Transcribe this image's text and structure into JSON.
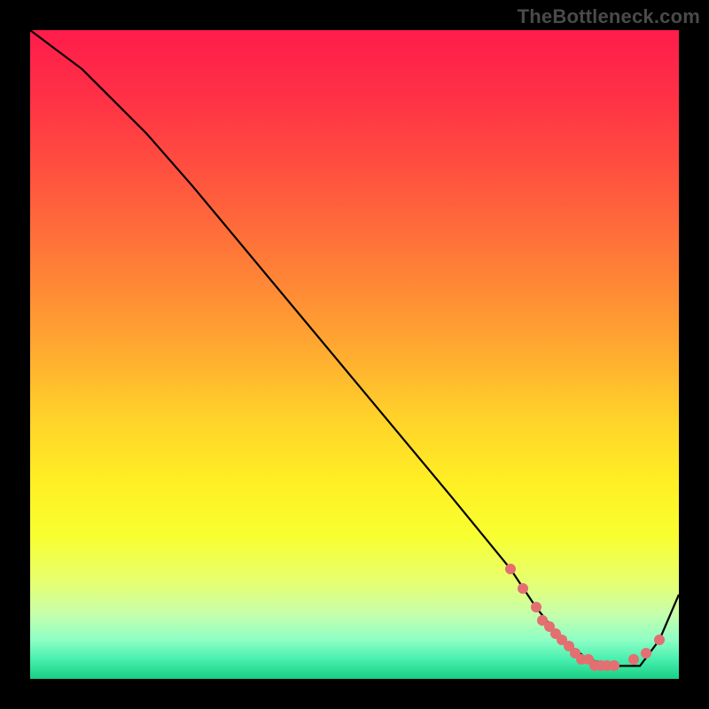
{
  "watermark": "TheBottleneck.com",
  "colors": {
    "dot": "#e36f71",
    "curve": "#000000",
    "frame": "#000000"
  },
  "gradient_stops": [
    {
      "offset": 0.0,
      "color": "#ff1c4b"
    },
    {
      "offset": 0.1,
      "color": "#ff3046"
    },
    {
      "offset": 0.22,
      "color": "#ff513f"
    },
    {
      "offset": 0.35,
      "color": "#ff7a38"
    },
    {
      "offset": 0.48,
      "color": "#ffa531"
    },
    {
      "offset": 0.6,
      "color": "#ffd32a"
    },
    {
      "offset": 0.7,
      "color": "#fff024"
    },
    {
      "offset": 0.78,
      "color": "#f8ff30"
    },
    {
      "offset": 0.85,
      "color": "#e7ff70"
    },
    {
      "offset": 0.9,
      "color": "#c6ffab"
    },
    {
      "offset": 0.94,
      "color": "#8effc5"
    },
    {
      "offset": 0.97,
      "color": "#48efae"
    },
    {
      "offset": 1.0,
      "color": "#19cf84"
    }
  ],
  "chart_data": {
    "type": "line",
    "title": "",
    "xlabel": "",
    "ylabel": "",
    "xlim": [
      0,
      100
    ],
    "ylim": [
      0,
      100
    ],
    "grid": false,
    "legend": false,
    "series": [
      {
        "name": "bottleneck-curve",
        "x": [
          0,
          4,
          8,
          12,
          18,
          25,
          35,
          50,
          65,
          74,
          78,
          82,
          86,
          90,
          94,
          97,
          100
        ],
        "y": [
          100,
          97,
          94,
          90,
          84,
          76,
          64,
          46,
          28,
          17,
          11,
          6,
          3,
          2,
          2,
          6,
          13
        ]
      }
    ],
    "highlight_points": {
      "name": "optimal-zone-dots",
      "x": [
        74,
        76,
        78,
        79,
        80,
        81,
        82,
        83,
        84,
        85,
        86,
        87,
        88,
        89,
        90,
        93,
        95,
        97
      ],
      "y": [
        17,
        14,
        11,
        9,
        8,
        7,
        6,
        5,
        4,
        3,
        3,
        2,
        2,
        2,
        2,
        3,
        4,
        6
      ]
    }
  }
}
